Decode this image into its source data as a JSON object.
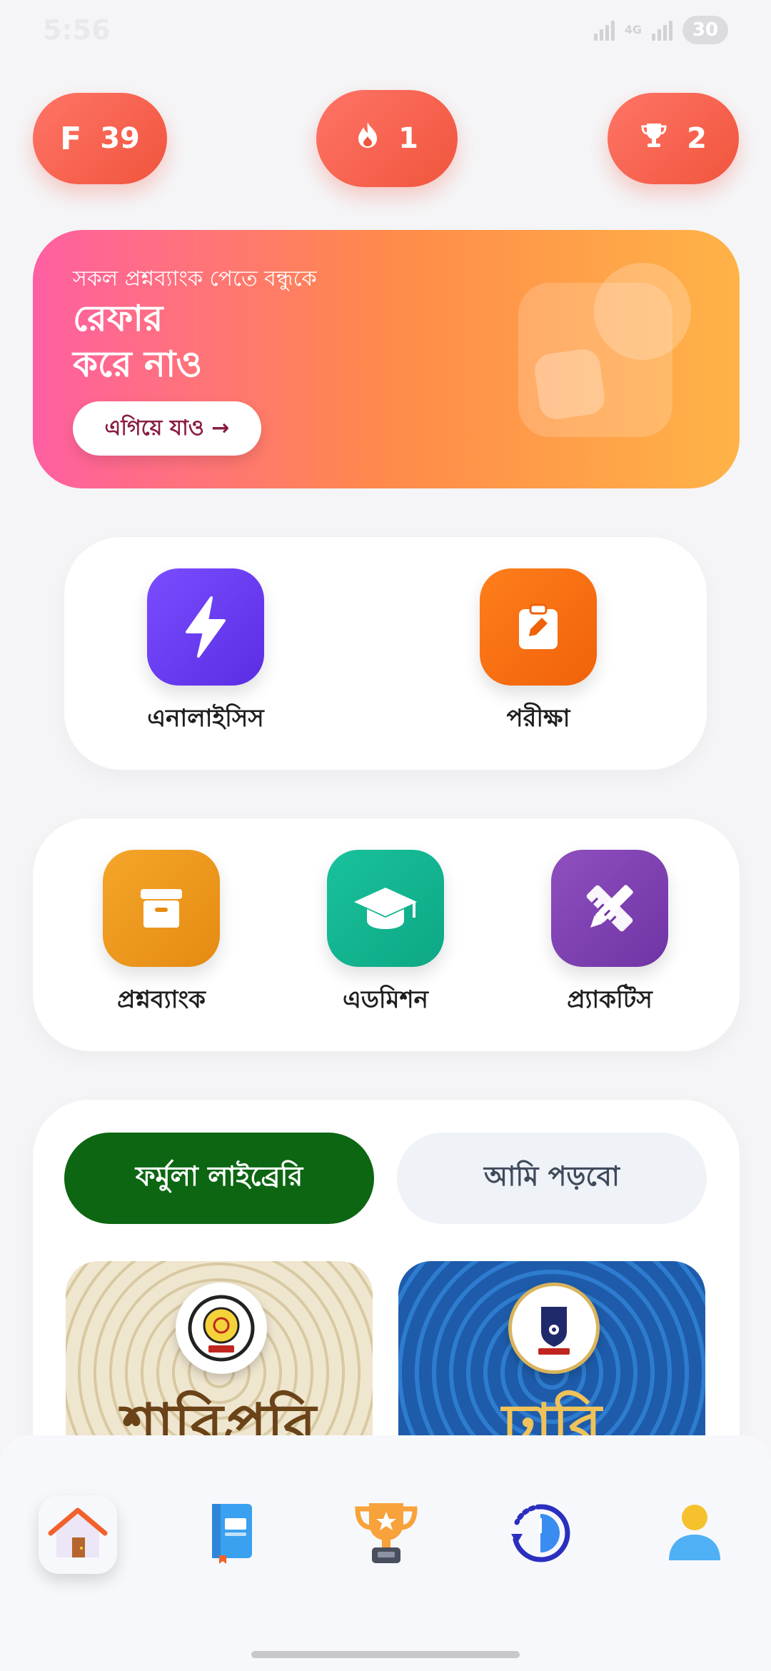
{
  "status_bar": {
    "time": "5:56",
    "network": "4G",
    "battery": "30"
  },
  "stats": {
    "points_letter": "F",
    "points": "39",
    "streak": "1",
    "trophies": "2"
  },
  "banner": {
    "subtitle": "সকল প্রশ্নব্যাংক পেতে বন্ধুকে",
    "title_line1": "রেফার",
    "title_line2": "করে নাও",
    "button_label": "এগিয়ে যাও →"
  },
  "primary_features": [
    {
      "label": "এনালাইসিস",
      "icon": "lightning-icon"
    },
    {
      "label": "পরীক্ষা",
      "icon": "clipboard-edit-icon"
    }
  ],
  "secondary_features": [
    {
      "label": "প্রশ্নব্যাংক",
      "icon": "archive-box-icon"
    },
    {
      "label": "এডমিশন",
      "icon": "graduation-cap-icon"
    },
    {
      "label": "প্র্যাকটিস",
      "icon": "pencil-ruler-icon"
    }
  ],
  "library": {
    "tabs": [
      {
        "label": "ফর্মুলা লাইব্রেরি",
        "active": true
      },
      {
        "label": "আমি পড়বো",
        "active": false
      }
    ],
    "books": [
      {
        "title": "শাবিপ্রবি",
        "emblem": "sust-seal-icon"
      },
      {
        "title": "ঢাবি",
        "emblem": "du-seal-icon"
      }
    ]
  },
  "bottom_nav": [
    {
      "name": "home",
      "icon": "home-icon"
    },
    {
      "name": "books",
      "icon": "book-icon"
    },
    {
      "name": "leaderboard",
      "icon": "trophy-icon"
    },
    {
      "name": "history",
      "icon": "history-icon"
    },
    {
      "name": "profile",
      "icon": "profile-icon"
    }
  ],
  "colors": {
    "pill": "#f0553d",
    "tab_active": "#0c6612",
    "tab_inactive": "#eff2f7"
  }
}
